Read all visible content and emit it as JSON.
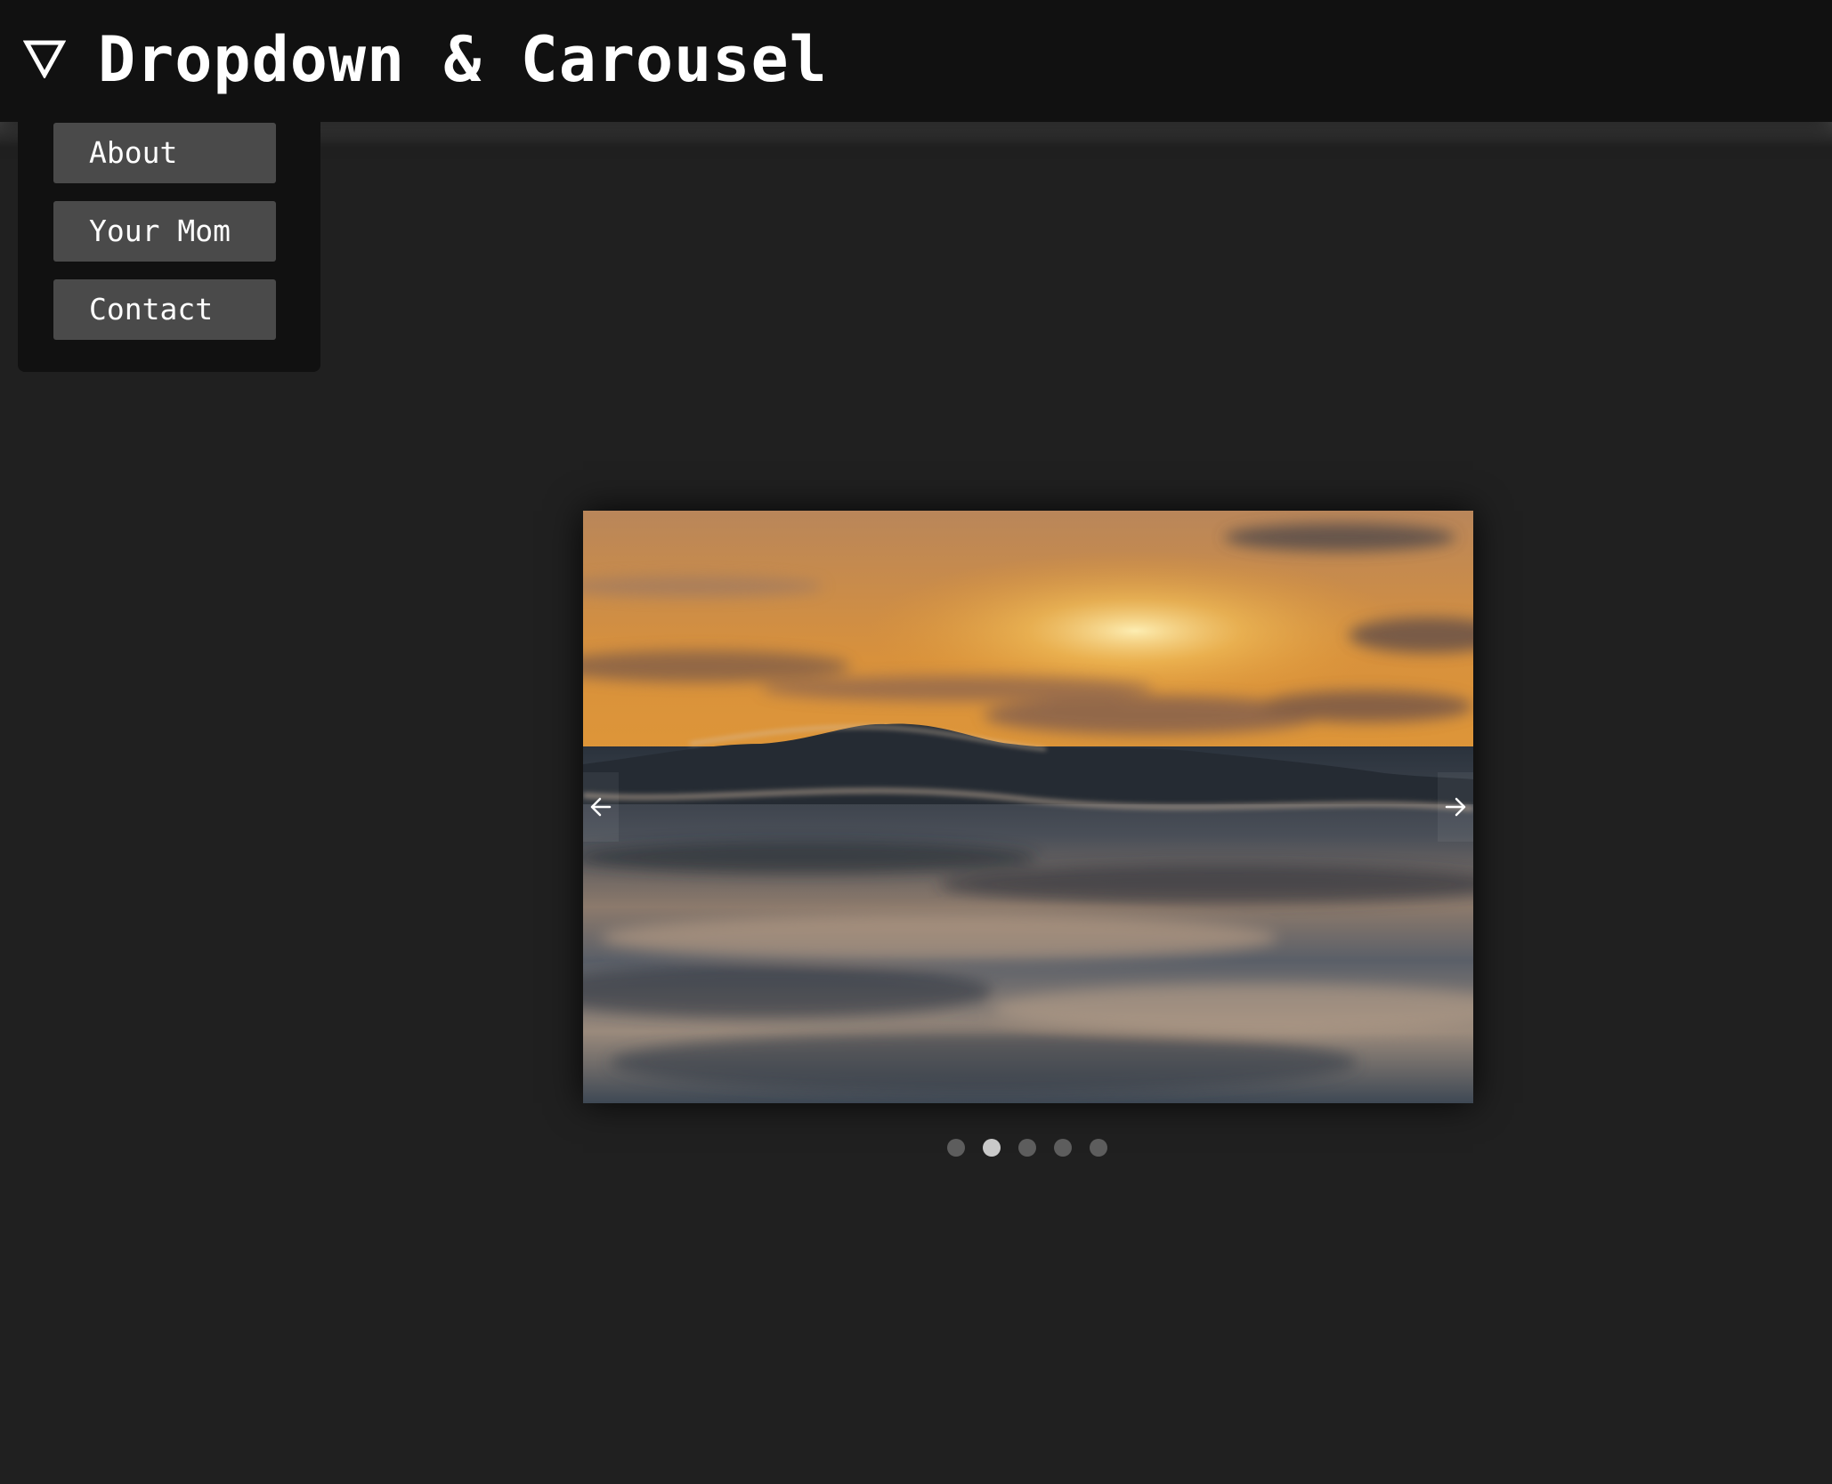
{
  "header": {
    "title": "Dropdown & Carousel",
    "toggle_icon": "triangle-down-outline-icon"
  },
  "dropdown": {
    "items": [
      {
        "label": "About"
      },
      {
        "label": "Your Mom"
      },
      {
        "label": "Contact"
      }
    ]
  },
  "carousel": {
    "current_slide": 2,
    "slide_count": 5,
    "image_subject": "ocean wave at sunset",
    "prev_icon": "arrow-left-icon",
    "next_icon": "arrow-right-icon"
  },
  "colors": {
    "page_background": "#202020",
    "header_background": "#111111",
    "menu_item_background": "#4a4a4a",
    "dot_inactive": "#5d5d5d",
    "dot_active": "#c9c9c9",
    "text": "#ffffff"
  }
}
